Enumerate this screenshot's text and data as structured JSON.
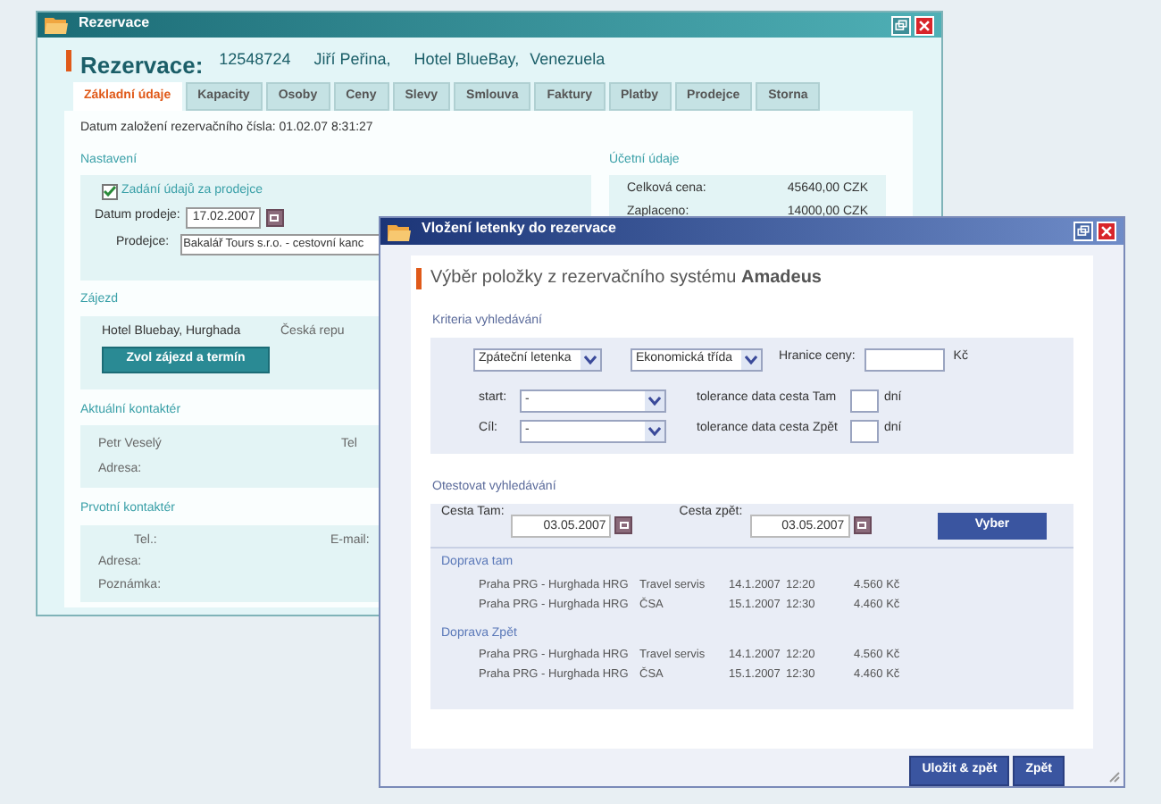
{
  "back_window": {
    "title": "Rezervace",
    "heading_label": "Rezervace:",
    "reservation_number": "12548724",
    "client": "Jiří Peřina,",
    "hotel": "Hotel BlueBay,",
    "country": "Venezuela",
    "tabs": [
      {
        "label": "Základní údaje",
        "selected": true
      },
      {
        "label": "Kapacity",
        "selected": false
      },
      {
        "label": "Osoby",
        "selected": false
      },
      {
        "label": "Ceny",
        "selected": false
      },
      {
        "label": "Slevy",
        "selected": false
      },
      {
        "label": "Smlouva",
        "selected": false
      },
      {
        "label": "Faktury",
        "selected": false
      },
      {
        "label": "Platby",
        "selected": false
      },
      {
        "label": "Prodejce",
        "selected": false
      },
      {
        "label": "Storna",
        "selected": false
      }
    ],
    "created": "Datum založení rezervačního čísla:  01.02.07 8:31:27",
    "settings": {
      "title": "Nastavení",
      "checkbox_label": "Zadání údajů za prodejce",
      "checked": true,
      "sale_date_label": "Datum prodeje:",
      "sale_date": "17.02.2007",
      "seller_label": "Prodejce:",
      "seller": "Bakalář Tours s.r.o. - cestovní kanc"
    },
    "trip": {
      "title": "Zájezd",
      "hotel": "Hotel Bluebay, Hurghada",
      "country": "Česká repu",
      "button": "Zvol zájezd a termín"
    },
    "current_contact": {
      "title": "Aktuální kontaktér",
      "name": "Petr  Veselý",
      "tel_label": "Tel",
      "address_label": "Adresa:"
    },
    "first_contact": {
      "title": "Prvotní kontaktér",
      "tel_label": "Tel.:",
      "email_label": "E-mail:",
      "address_label": "Adresa:",
      "note_label": "Poznámka:"
    },
    "accounting": {
      "title": "Účetní údaje",
      "rows": [
        {
          "label": "Celková cena:",
          "value": "45640,00 CZK"
        },
        {
          "label": "Zaplaceno:",
          "value": "14000,00 CZK"
        }
      ]
    }
  },
  "front_window": {
    "title": "Vložení letenky do rezervace",
    "heading": "Výběr položky z rezervačního systému **Amadeus**",
    "criteria": {
      "title": "Kriteria vyhledávání",
      "ticket_type": "Zpáteční letenka",
      "travel_class": "Ekonomická třída",
      "price_label": "Hranice ceny:",
      "currency": "Kč",
      "start_label": "start:",
      "start_value": "-",
      "destination_label": "Cíl:",
      "destination_value": "-",
      "tolerance_there_label": "tolerance data cesta Tam",
      "tolerance_there_unit": "dní",
      "tolerance_back_label": "tolerance data cesta Zpět",
      "tolerance_back_unit": "dní"
    },
    "test": {
      "title": "Otestovat vyhledávání",
      "there_label": "Cesta Tam:",
      "there_date": "03.05.2007",
      "back_label": "Cesta zpět:",
      "back_date": "03.05.2007",
      "button": "Vyber",
      "groups": [
        {
          "title": "Doprava tam",
          "rows": [
            {
              "route": "Praha PRG - Hurghada HRG",
              "carrier": "Travel servis",
              "date": "14.1.2007",
              "time": "12:20",
              "price": "4.560 Kč"
            },
            {
              "route": "Praha PRG - Hurghada HRG",
              "carrier": "ČSA",
              "date": "15.1.2007",
              "time": "12:30",
              "price": "4.460 Kč"
            }
          ]
        },
        {
          "title": "Doprava Zpět",
          "rows": [
            {
              "route": "Praha PRG - Hurghada HRG",
              "carrier": "Travel servis",
              "date": "14.1.2007",
              "time": "12:20",
              "price": "4.560 Kč"
            },
            {
              "route": "Praha PRG - Hurghada HRG",
              "carrier": "ČSA",
              "date": "15.1.2007",
              "time": "12:30",
              "price": "4.460 Kč"
            }
          ]
        }
      ]
    },
    "buttons": [
      "Uložit & zpět",
      "Zpět"
    ]
  }
}
